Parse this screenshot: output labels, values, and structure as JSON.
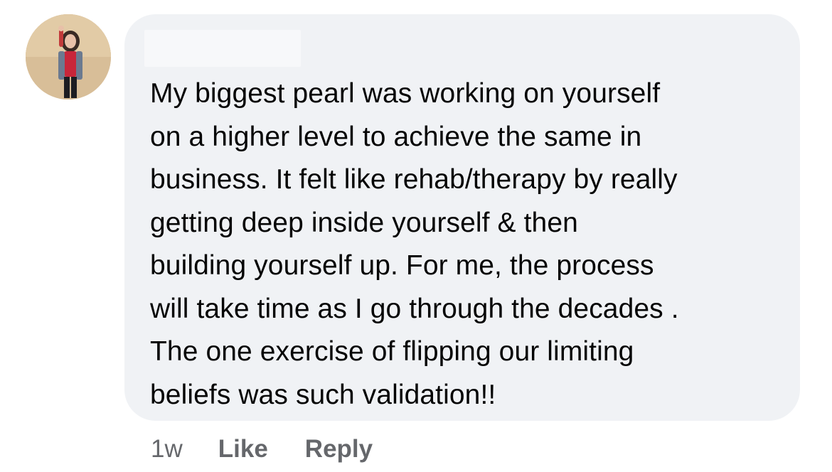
{
  "comment": {
    "author_avatar": "avatar",
    "text": "My biggest pearl was working on yourself\non a higher  level to achieve the same in\nbusiness. It felt like rehab/therapy by really\ngetting deep inside yourself & then\nbuilding yourself up. For me, the process\nwill take time as I go through the decades .\nThe one exercise of flipping our limiting\nbeliefs was such validation!!",
    "bubble_color": "#f0f2f5",
    "text_color": "#050505"
  },
  "actions": {
    "timestamp": "1w",
    "like_label": "Like",
    "reply_label": "Reply",
    "color": "#65676b"
  }
}
